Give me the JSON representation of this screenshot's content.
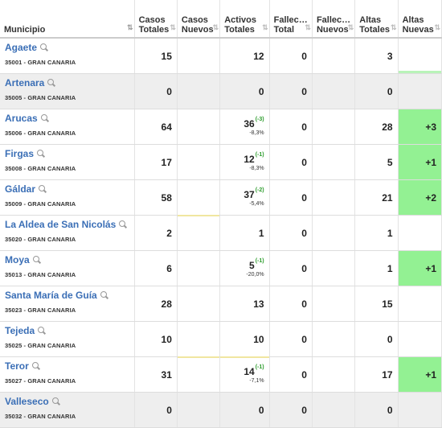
{
  "headers": [
    {
      "label": "Municipio"
    },
    {
      "label": "Casos\nTotales"
    },
    {
      "label": "Casos\nNuevos"
    },
    {
      "label": "Activos\nTotales"
    },
    {
      "label": "Fallec…\nTotal"
    },
    {
      "label": "Fallec…\nNuevos"
    },
    {
      "label": "Altas\nTotales"
    },
    {
      "label": "Altas\nNuevas"
    }
  ],
  "rows": [
    {
      "name": "Agaete",
      "code": "35001 - GRAN CANARIA",
      "casos_totales": "15",
      "casos_nuevos": "",
      "activos": "12",
      "activos_delta": "",
      "activos_pct": "",
      "fallec_total": "0",
      "fallec_nuevos": "",
      "altas_totales": "3",
      "altas_nuevas": ""
    },
    {
      "name": "Artenara",
      "code": "35005 - GRAN CANARIA",
      "casos_totales": "0",
      "casos_nuevos": "",
      "activos": "0",
      "activos_delta": "",
      "activos_pct": "",
      "fallec_total": "0",
      "fallec_nuevos": "",
      "altas_totales": "0",
      "altas_nuevas": ""
    },
    {
      "name": "Arucas",
      "code": "35006 - GRAN CANARIA",
      "casos_totales": "64",
      "casos_nuevos": "",
      "activos": "36",
      "activos_delta": "(-3)",
      "activos_pct": "-8,3%",
      "fallec_total": "0",
      "fallec_nuevos": "",
      "altas_totales": "28",
      "altas_nuevas": "+3"
    },
    {
      "name": "Firgas",
      "code": "35008 - GRAN CANARIA",
      "casos_totales": "17",
      "casos_nuevos": "",
      "activos": "12",
      "activos_delta": "(-1)",
      "activos_pct": "-8,3%",
      "fallec_total": "0",
      "fallec_nuevos": "",
      "altas_totales": "5",
      "altas_nuevas": "+1"
    },
    {
      "name": "Gáldar",
      "code": "35009 - GRAN CANARIA",
      "casos_totales": "58",
      "casos_nuevos": "",
      "activos": "37",
      "activos_delta": "(-2)",
      "activos_pct": "-5,4%",
      "fallec_total": "0",
      "fallec_nuevos": "",
      "altas_totales": "21",
      "altas_nuevas": "+2"
    },
    {
      "name": "La Aldea de San Nicolás",
      "code": "35020 - GRAN CANARIA",
      "casos_totales": "2",
      "casos_nuevos": "",
      "activos": "1",
      "activos_delta": "",
      "activos_pct": "",
      "fallec_total": "0",
      "fallec_nuevos": "",
      "altas_totales": "1",
      "altas_nuevas": ""
    },
    {
      "name": "Moya",
      "code": "35013 - GRAN CANARIA",
      "casos_totales": "6",
      "casos_nuevos": "",
      "activos": "5",
      "activos_delta": "(-1)",
      "activos_pct": "-20,0%",
      "fallec_total": "0",
      "fallec_nuevos": "",
      "altas_totales": "1",
      "altas_nuevas": "+1"
    },
    {
      "name": "Santa María de Guía",
      "code": "35023 - GRAN CANARIA",
      "casos_totales": "28",
      "casos_nuevos": "",
      "activos": "13",
      "activos_delta": "",
      "activos_pct": "",
      "fallec_total": "0",
      "fallec_nuevos": "",
      "altas_totales": "15",
      "altas_nuevas": ""
    },
    {
      "name": "Tejeda",
      "code": "35025 - GRAN CANARIA",
      "casos_totales": "10",
      "casos_nuevos": "",
      "activos": "10",
      "activos_delta": "",
      "activos_pct": "",
      "fallec_total": "0",
      "fallec_nuevos": "",
      "altas_totales": "0",
      "altas_nuevas": ""
    },
    {
      "name": "Teror",
      "code": "35027 - GRAN CANARIA",
      "casos_totales": "31",
      "casos_nuevos": "",
      "activos": "14",
      "activos_delta": "(-1)",
      "activos_pct": "-7,1%",
      "fallec_total": "0",
      "fallec_nuevos": "",
      "altas_totales": "17",
      "altas_nuevas": "+1"
    },
    {
      "name": "Valleseco",
      "code": "35032 - GRAN CANARIA",
      "casos_totales": "0",
      "casos_nuevos": "",
      "activos": "0",
      "activos_delta": "",
      "activos_pct": "",
      "fallec_total": "0",
      "fallec_nuevos": "",
      "altas_totales": "0",
      "altas_nuevas": ""
    }
  ],
  "colors": {
    "link": "#3b6fb6",
    "green_cell": "#93f193",
    "delta_green": "#2c9c2c",
    "gray_row": "#eeeeee"
  },
  "icons": {
    "sort": "sort-icon",
    "search": "search-icon"
  }
}
